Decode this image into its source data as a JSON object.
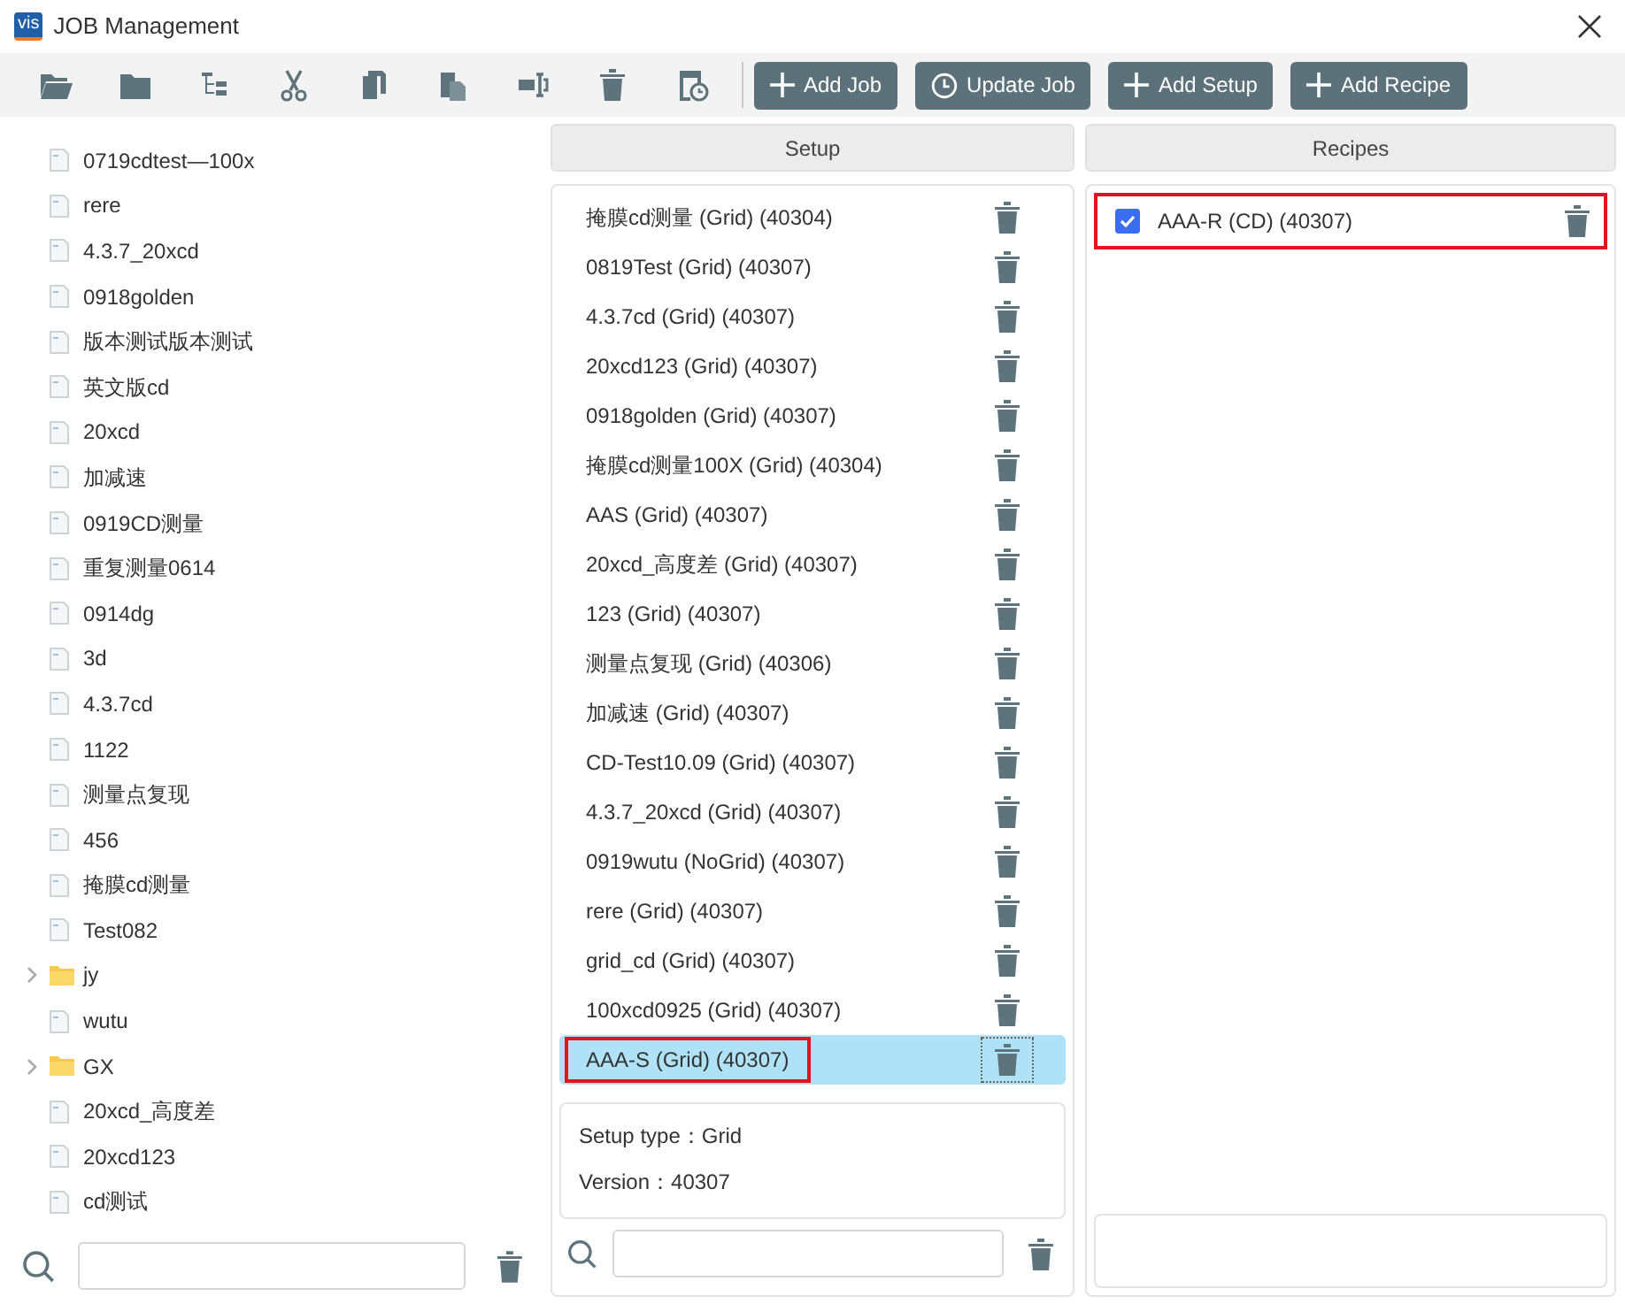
{
  "window": {
    "title": "JOB Management",
    "logo": "vis"
  },
  "toolbar": {
    "buttons": [
      {
        "label": "Add Job",
        "kind": "add"
      },
      {
        "label": "Update Job",
        "kind": "update"
      },
      {
        "label": "Add Setup",
        "kind": "add"
      },
      {
        "label": "Add Recipe",
        "kind": "add"
      }
    ]
  },
  "jobs": {
    "items": [
      {
        "label": "0719cdtest—100x",
        "kind": "file"
      },
      {
        "label": "rere",
        "kind": "file"
      },
      {
        "label": "4.3.7_20xcd",
        "kind": "file"
      },
      {
        "label": "0918golden",
        "kind": "file"
      },
      {
        "label": "版本测试版本测试",
        "kind": "file"
      },
      {
        "label": "英文版cd",
        "kind": "file"
      },
      {
        "label": "20xcd",
        "kind": "file"
      },
      {
        "label": "加减速",
        "kind": "file"
      },
      {
        "label": "0919CD测量",
        "kind": "file"
      },
      {
        "label": "重复测量0614",
        "kind": "file"
      },
      {
        "label": "0914dg",
        "kind": "file"
      },
      {
        "label": "3d",
        "kind": "file"
      },
      {
        "label": "4.3.7cd",
        "kind": "file"
      },
      {
        "label": "1122",
        "kind": "file"
      },
      {
        "label": "测量点复现",
        "kind": "file"
      },
      {
        "label": "456",
        "kind": "file"
      },
      {
        "label": "掩膜cd测量",
        "kind": "file"
      },
      {
        "label": "Test082",
        "kind": "file"
      },
      {
        "label": "jy",
        "kind": "folder",
        "expanded": false
      },
      {
        "label": "wutu",
        "kind": "file"
      },
      {
        "label": "GX",
        "kind": "folder",
        "expanded": false
      },
      {
        "label": "20xcd_高度差",
        "kind": "file"
      },
      {
        "label": "20xcd123",
        "kind": "file"
      },
      {
        "label": "cd测试",
        "kind": "file"
      }
    ]
  },
  "setup": {
    "header": "Setup",
    "items": [
      {
        "label": "掩膜cd测量 (Grid) (40304)",
        "selected": false,
        "outlined": false
      },
      {
        "label": "0819Test (Grid) (40307)",
        "selected": false,
        "outlined": false
      },
      {
        "label": "4.3.7cd (Grid) (40307)",
        "selected": false,
        "outlined": false
      },
      {
        "label": "20xcd123 (Grid) (40307)",
        "selected": false,
        "outlined": false
      },
      {
        "label": "0918golden (Grid) (40307)",
        "selected": false,
        "outlined": false
      },
      {
        "label": "掩膜cd测量100X (Grid) (40304)",
        "selected": false,
        "outlined": false
      },
      {
        "label": "AAS (Grid) (40307)",
        "selected": false,
        "outlined": false
      },
      {
        "label": "20xcd_高度差 (Grid) (40307)",
        "selected": false,
        "outlined": false
      },
      {
        "label": "123 (Grid) (40307)",
        "selected": false,
        "outlined": false
      },
      {
        "label": "测量点复现 (Grid) (40306)",
        "selected": false,
        "outlined": false
      },
      {
        "label": "加减速 (Grid) (40307)",
        "selected": false,
        "outlined": false
      },
      {
        "label": "CD-Test10.09 (Grid) (40307)",
        "selected": false,
        "outlined": false
      },
      {
        "label": "4.3.7_20xcd (Grid) (40307)",
        "selected": false,
        "outlined": false
      },
      {
        "label": "0919wutu (NoGrid) (40307)",
        "selected": false,
        "outlined": false
      },
      {
        "label": "rere (Grid) (40307)",
        "selected": false,
        "outlined": false
      },
      {
        "label": "grid_cd (Grid) (40307)",
        "selected": false,
        "outlined": false
      },
      {
        "label": "100xcd0925 (Grid) (40307)",
        "selected": false,
        "outlined": false
      },
      {
        "label": "AAA-S (Grid) (40307)",
        "selected": true,
        "outlined": true
      }
    ],
    "details": [
      "Setup type：Grid",
      "Version：40307"
    ]
  },
  "recipes": {
    "header": "Recipes",
    "items": [
      {
        "label": "AAA-R (CD) (40307)",
        "checked": true,
        "outlined": true
      }
    ]
  }
}
